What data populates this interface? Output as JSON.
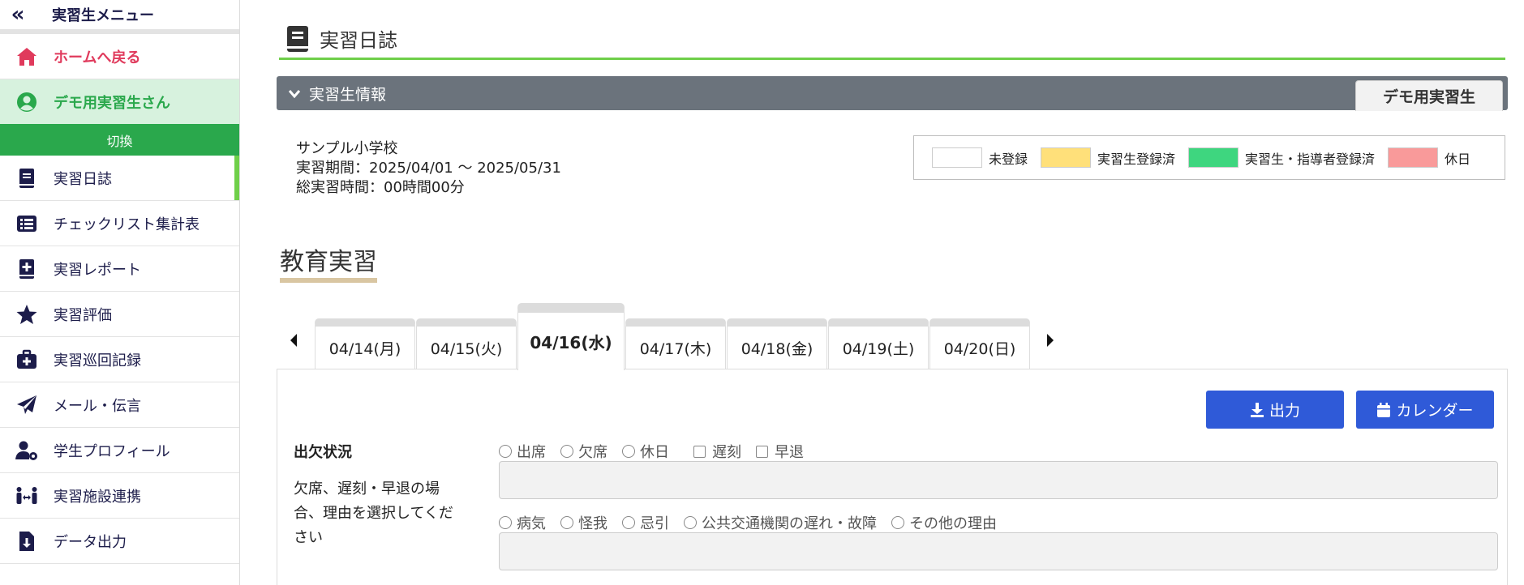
{
  "sidebar": {
    "title": "実習生メニュー",
    "collapse_glyph": "«",
    "home_label": "ホームへ戻る",
    "user_label": "デモ用実習生さん",
    "switch_label": "切換",
    "items": [
      {
        "label": "実習日誌",
        "icon": "book-icon"
      },
      {
        "label": "チェックリスト集計表",
        "icon": "list-icon"
      },
      {
        "label": "実習レポート",
        "icon": "report-plus-icon"
      },
      {
        "label": "実習評価",
        "icon": "star-icon"
      },
      {
        "label": "実習巡回記録",
        "icon": "medkit-icon"
      },
      {
        "label": "メール・伝言",
        "icon": "paper-plane-icon"
      },
      {
        "label": "学生プロフィール",
        "icon": "user-gear-icon"
      },
      {
        "label": "実習施設連携",
        "icon": "people-arrows-icon"
      },
      {
        "label": "データ出力",
        "icon": "file-download-icon"
      }
    ]
  },
  "header": {
    "title": "実習日誌"
  },
  "info_bar": {
    "title": "実習生情報",
    "student_tab": "デモ用実習生"
  },
  "school": {
    "name": "サンプル小学校",
    "period": "実習期間：2025/04/01 〜 2025/05/31",
    "total_hours": "総実習時間：00時間00分"
  },
  "legend": [
    {
      "label": "未登録",
      "color": "#ffffff"
    },
    {
      "label": "実習生登録済",
      "color": "#ffe07a"
    },
    {
      "label": "実習生・指導者登録済",
      "color": "#3ed67f"
    },
    {
      "label": "休日",
      "color": "#f99a9a"
    }
  ],
  "section_title": "教育実習",
  "tabs": [
    {
      "label": "04/14(月)"
    },
    {
      "label": "04/15(火)"
    },
    {
      "label": "04/16(水)",
      "active": true
    },
    {
      "label": "04/17(木)"
    },
    {
      "label": "04/18(金)"
    },
    {
      "label": "04/19(土)"
    },
    {
      "label": "04/20(日)"
    }
  ],
  "buttons": {
    "output": "出力",
    "calendar": "カレンダー"
  },
  "attendance": {
    "label": "出欠状況",
    "note": "欠席、遅刻・早退の場合、理由を選択してください",
    "status_radios": [
      "出席",
      "欠席",
      "休日"
    ],
    "status_checks": [
      "遅刻",
      "早退"
    ],
    "reason_radios": [
      "病気",
      "怪我",
      "忌引",
      "公共交通機関の遅れ・故障",
      "その他の理由"
    ]
  },
  "colors": {
    "accent_green": "#2aa84c",
    "button_blue": "#2f5ad8",
    "home_red": "#e03a5c",
    "nav_navy": "#1c1c4a"
  }
}
